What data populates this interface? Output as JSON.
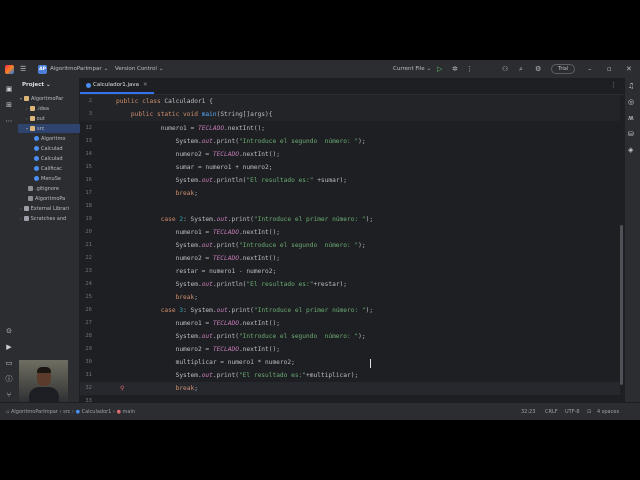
{
  "titlebar": {
    "project_badge": "AP",
    "project_name": "AlgoritmoParImpar",
    "vcs": "Version Control",
    "run_config": "Current File",
    "trial": "Trial"
  },
  "project_panel": {
    "header": "Project",
    "items": [
      {
        "label": "AlgoritmoPar",
        "icon": "folder-icon",
        "arrow": "▾"
      },
      {
        "label": ".idea",
        "icon": "folder-icon",
        "arrow": "›"
      },
      {
        "label": "out",
        "icon": "folder-icon",
        "arrow": "›"
      },
      {
        "label": "src",
        "icon": "folder-icon",
        "arrow": "▾"
      },
      {
        "label": "Algoritmo",
        "icon": "java-class-icon",
        "arrow": ""
      },
      {
        "label": "Calculad",
        "icon": "java-class-icon",
        "arrow": ""
      },
      {
        "label": "Calculad",
        "icon": "java-class-icon",
        "arrow": ""
      },
      {
        "label": "Calificac",
        "icon": "java-class-icon",
        "arrow": ""
      },
      {
        "label": "MenuSe",
        "icon": "java-class-icon",
        "arrow": ""
      },
      {
        "label": ".gitignore",
        "icon": "file-icon",
        "arrow": ""
      },
      {
        "label": "AlgoritmoPa",
        "icon": "file-icon",
        "arrow": ""
      },
      {
        "label": "External Librari",
        "icon": "library-icon",
        "arrow": "›"
      },
      {
        "label": "Scratches and",
        "icon": "scratch-icon",
        "arrow": "›"
      }
    ]
  },
  "editor": {
    "tab": "Calculador1.java",
    "warnings": "4",
    "weak_warnings": "15",
    "sticky": [
      {
        "n": "2",
        "html": "<span class='kw'>public class</span> Calculador1 {"
      },
      {
        "n": "3",
        "html": "    <span class='kw'>public static void</span> <span class='fn'>main</span>(String[]args){"
      }
    ],
    "lines": [
      {
        "n": "12",
        "html": "            numero1 = <span class='fld'>TECLADO</span>.nextInt();"
      },
      {
        "n": "13",
        "html": "                System.<span class='fld'>out</span>.print(<span class='str'>\"Introduce el segundo  número: \"</span>);"
      },
      {
        "n": "14",
        "html": "                numero2 = <span class='fld'>TECLADO</span>.nextInt();"
      },
      {
        "n": "15",
        "html": "                sumar = numero1 + numero2;"
      },
      {
        "n": "16",
        "html": "                System.<span class='fld'>out</span>.println(<span class='str'>\"El resultado es:\"</span> +sumar);"
      },
      {
        "n": "17",
        "html": "                <span class='kw'>break</span>;"
      },
      {
        "n": "18",
        "html": ""
      },
      {
        "n": "19",
        "html": "            <span class='kw'>case</span> <span class='num'>2</span>: System.<span class='fld'>out</span>.print(<span class='str'>\"Introduce el primer número: \"</span>);"
      },
      {
        "n": "20",
        "html": "                numero1 = <span class='fld'>TECLADO</span>.nextInt();"
      },
      {
        "n": "21",
        "html": "                System.<span class='fld'>out</span>.print(<span class='str'>\"Introduce el segundo  número: \"</span>);"
      },
      {
        "n": "22",
        "html": "                numero2 = <span class='fld'>TECLADO</span>.nextInt();"
      },
      {
        "n": "23",
        "html": "                restar = numero1 - numero2;"
      },
      {
        "n": "24",
        "html": "                System.<span class='fld'>out</span>.println(<span class='str'>\"El resultado es:\"</span>+restar);"
      },
      {
        "n": "25",
        "html": "                <span class='kw'>break</span>;"
      },
      {
        "n": "26",
        "html": "            <span class='kw'>case</span> <span class='num'>3</span>: System.<span class='fld'>out</span>.print(<span class='str'>\"Introduce el primer número: \"</span>);"
      },
      {
        "n": "27",
        "html": "                numero1 = <span class='fld'>TECLADO</span>.nextInt();"
      },
      {
        "n": "28",
        "html": "                System.<span class='fld'>out</span>.print(<span class='str'>\"Introduce el segundo  número: \"</span>);"
      },
      {
        "n": "29",
        "html": "                numero2 = <span class='fld'>TECLADO</span>.nextInt();"
      },
      {
        "n": "30",
        "html": "                multiplicar = numero1 * numero2;"
      },
      {
        "n": "31",
        "html": "                System.<span class='fld'>out</span>.print(<span class='str'>\"El resultado es:\"</span>+multiplicar);"
      },
      {
        "n": "32",
        "html": "                <span class='kw'>break</span>;"
      },
      {
        "n": "33",
        "html": ""
      }
    ]
  },
  "statusbar": {
    "breadcrumb": [
      "AlgoritmoParImpar",
      "src",
      "Calculador1",
      "main"
    ],
    "position": "32:23",
    "line_sep": "CRLF",
    "encoding": "UTF-8",
    "indent": "4 spaces"
  },
  "colors": {
    "background": "#1e1f22",
    "panel": "#2b2d30",
    "keyword": "#cf8e6d",
    "string": "#6aab73",
    "static_field": "#c77dbb",
    "method": "#56a8f5",
    "accent": "#3574f0"
  }
}
